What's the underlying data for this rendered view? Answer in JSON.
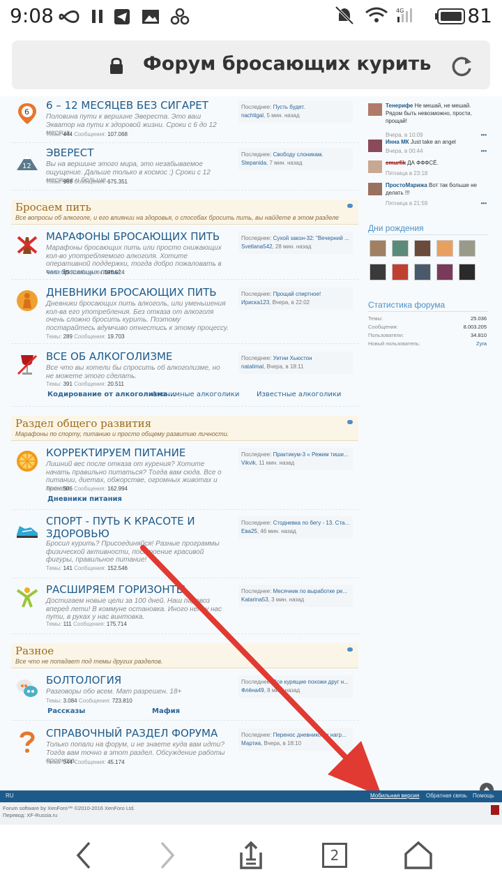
{
  "status": {
    "time": "9:08",
    "network": "4G",
    "battery": "81"
  },
  "urlbar": {
    "title": "Форум бросающих курить"
  },
  "forums_top": [
    {
      "title": "6 – 12 МЕСЯЦЕВ БЕЗ СИГАРЕТ",
      "desc": "Половина пути к вершине Эвереста. Это ваш Экватор на пути к здоровой жизни. Сроки с 6 до 12 месяца.",
      "threads_label": "Темы:",
      "threads": "444",
      "posts_label": "Сообщения:",
      "posts": "107.068",
      "last_label": "Последнее:",
      "last_title": "Пусть будет.",
      "last_user": "nachtigal",
      "last_time": ", 5 мин. назад"
    },
    {
      "title": "ЭВЕРЕСТ",
      "desc": "Вы на вершине этого мира, это незабываемое ощущение. Дальше только в космос :) Сроки с 12 месяцев и больше.",
      "threads_label": "Темы:",
      "threads": "986",
      "posts_label": "Сообщения:",
      "posts": "675.351",
      "last_label": "Последнее:",
      "last_title": "Свободу слоникам.",
      "last_user": "Stepanida",
      "last_time": ", 7 мин. назад"
    }
  ],
  "categories": [
    {
      "name": "Бросаем пить",
      "desc": "Все вопросы об алкоголе, и его влиянии на здоровья, о способах бросить пить, вы найдете в этом разделе"
    },
    {
      "name": "Раздел общего развития",
      "desc": "Марафоны по спорту, питанию и просто общему развитию личности."
    },
    {
      "name": "Разное",
      "desc": "Все что не попадает под темы других разделов."
    }
  ],
  "forums_drink": [
    {
      "title": "МАРАФОНЫ БРОСАЮЩИХ ПИТЬ",
      "desc": "Марафоны бросающих пить или просто снижающих кол-во употребляемого алкоголя. Хотите оперативной поддержки, тогда добро пожаловать в ",
      "desc_link": "чат бросающих пить!",
      "threads_label": "Темы:",
      "threads": "65",
      "posts_label": "Сообщения:",
      "posts": "396.624",
      "last_label": "Последнее:",
      "last_title": "Сухой закон-32: \"Вечерний ...",
      "last_user": "Svetlana542",
      "last_time": ", 28 мин. назад"
    },
    {
      "title": "ДНЕВНИКИ БРОСАЮЩИХ ПИТЬ",
      "desc": "Дневники бросающих пить алкоголь, или уменьшения кол-ва его употребления. Без отказа от алкоголя очень сложно бросить курить. Поэтому постарайтесь вдумчиво отнестись к этому процессу.",
      "threads_label": "Темы:",
      "threads": "289",
      "posts_label": "Сообщения:",
      "posts": "19.703",
      "last_label": "Последнее:",
      "last_title": "Прощай спиртное!",
      "last_user": "Ириска123",
      "last_time": ", Вчера, в 22:02"
    },
    {
      "title": "ВСЕ ОБ АЛКОГОЛИЗМЕ",
      "desc": "Все что вы хотели бы спросить об алкоголизме, но не можете этого сделать.",
      "threads_label": "Темы:",
      "threads": "391",
      "posts_label": "Сообщения:",
      "posts": "20.511",
      "last_label": "Последнее:",
      "last_title": "Уитни Хьюстон",
      "last_user": "natalimal",
      "last_time": ", Вчера, в 18:11",
      "subs": [
        "Кодирование от алкоголизма...",
        "Анонимные алкоголики",
        "Известные алкоголики"
      ]
    }
  ],
  "forums_dev": [
    {
      "title": "КОРРЕКТИРУЕМ ПИТАНИЕ",
      "desc": "Лишний вес после отказа от курения? Хотите начать правильно питаться? Тогда вам сюда. Все о питании, диетах, обжорстве, огромных животах и прочем.",
      "threads_label": "Темы:",
      "threads": "506",
      "posts_label": "Сообщения:",
      "posts": "162.994",
      "last_label": "Последнее:",
      "last_title": "Практикум-3 « Режим тиши...",
      "last_user": "Vikvik",
      "last_time": ", 11 мин. назад",
      "subs": [
        "Дневники питания"
      ]
    },
    {
      "title": "СПОРТ - ПУТЬ К КРАСОТЕ И",
      "title2": "ЗДОРОВЬЮ",
      "desc": "Бросил курить? Присоединяйся! Разные программы физической активности, построение красивой фигуры, правильное питание!",
      "threads_label": "Темы:",
      "threads": "141",
      "posts_label": "Сообщения:",
      "posts": "152.546",
      "last_label": "Последнее:",
      "last_title": "Стодневка по бегу - 13. Ста...",
      "last_user": "Ева25",
      "last_time": ", 46 мин. назад"
    },
    {
      "title": "РАСШИРЯЕМ ГОРИЗОНТЫ",
      "desc": "Достигаем новые цели за 100 дней. Наш паровоз вперед лети! В коммуне остановка. Иного нет у нас пути, в руках у нас винтовка.",
      "threads_label": "Темы:",
      "threads": "111",
      "posts_label": "Сообщения:",
      "posts": "175.714",
      "last_label": "Последнее:",
      "last_title": "Месячник по выработке ре...",
      "last_user": "Katarina53",
      "last_time": ", 3 мин. назад"
    }
  ],
  "forums_misc": [
    {
      "title": "БОЛТОЛОГИЯ",
      "desc": "Разговоры обо всем. Мат разрешен. 18+",
      "threads_label": "Темы:",
      "threads": "3.084",
      "posts_label": "Сообщения:",
      "posts": "723.810",
      "last_label": "Последнее:",
      "last_title": "Все курящие похожи друг н...",
      "last_user": "Флёна49",
      "last_time": ", 8 мин. назад",
      "subs": [
        "Рассказы",
        "Мафия"
      ]
    },
    {
      "title": "СПРАВОЧНЫЙ РАЗДЕЛ ФОРУМА",
      "desc": "Только попали на форум, и не знаете куда вам идти? Тогда вам точно в этот раздел. Обсуждение работы проекта.",
      "threads_label": "Темы:",
      "threads": "344",
      "posts_label": "Сообщения:",
      "posts": "45.174",
      "last_label": "Последнее:",
      "last_title": "Перенос дневников и нагр...",
      "last_user": "Мартиа",
      "last_time": ", Вчера, в 18:10"
    }
  ],
  "chat": [
    {
      "nick": "Тенерифе",
      "text": "Не мешай, не мешай. Рядом быть невозможно, прости, прощай!",
      "when": "Вчера, в 10:09"
    },
    {
      "nick": "Инна МК",
      "text": "Just take an angel",
      "when": "Вчера, в 00:44"
    },
    {
      "nick": "cmurfik",
      "text": "ДА ФФФСЁ.",
      "when": "Пятница в 23:18"
    },
    {
      "nick": "ПростоМарижа",
      "text": "Вот так больше не делать !!!",
      "when": "Пятница в 21:59"
    }
  ],
  "more_glyph": "•••",
  "birthdays": {
    "title": "Дни рождения"
  },
  "stats": {
    "title": "Статистика форума",
    "rows": [
      {
        "label": "Темы:",
        "value": "25.036"
      },
      {
        "label": "Сообщения:",
        "value": "8.003.205"
      },
      {
        "label": "Пользователи:",
        "value": "34.810"
      },
      {
        "label": "Новый пользователь:",
        "value": "Zyra"
      }
    ]
  },
  "footer": {
    "lang": "RU",
    "mobile": "Мобильная версия",
    "feedback": "Обратная связь",
    "help": "Помощь",
    "copyright": "Forum software by XenForo™ ©2010-2016 XenForo Ltd.",
    "translation": "Перевод: XF-Russia.ru"
  },
  "nav": {
    "tabs_count": "2"
  },
  "colors": {
    "accent": "#1d5a8a",
    "category_bg": "#fbf5e7",
    "arrow": "#e03a32"
  }
}
